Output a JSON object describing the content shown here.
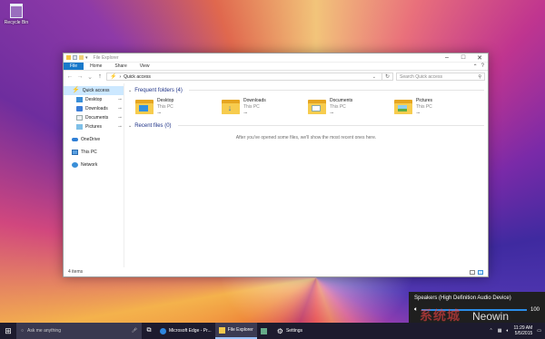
{
  "desktop": {
    "recycle_bin_label": "Recycle Bin"
  },
  "window": {
    "title": "File Explorer",
    "controls": {
      "minimize": "–",
      "maximize": "□",
      "close": "✕"
    },
    "ribbon_tabs": [
      "File",
      "Home",
      "Share",
      "View"
    ],
    "ribbon_right": {
      "collapse": "⌃",
      "help": "?"
    },
    "address": {
      "location": "Quick access",
      "search_placeholder": "Search Quick access"
    }
  },
  "nav_pane": {
    "quick_access": "Quick access",
    "pinned": [
      "Desktop",
      "Downloads",
      "Documents",
      "Pictures"
    ],
    "onedrive": "OneDrive",
    "this_pc": "This PC",
    "network": "Network"
  },
  "content": {
    "frequent_header": "Frequent folders (4)",
    "folders": [
      {
        "name": "Desktop",
        "location": "This PC"
      },
      {
        "name": "Downloads",
        "location": "This PC"
      },
      {
        "name": "Documents",
        "location": "This PC"
      },
      {
        "name": "Pictures",
        "location": "This PC"
      }
    ],
    "recent_header": "Recent files (0)",
    "recent_empty": "After you've opened some files, we'll show the most recent ones here."
  },
  "status_bar": {
    "item_count": "4 items"
  },
  "volume_flyout": {
    "device": "Speakers (High Definition Audio Device)",
    "level": 100,
    "level_label": "100"
  },
  "watermark": {
    "text_cn": "系统城",
    "text_en": "Neowin"
  },
  "taskbar": {
    "search_placeholder": "Ask me anything",
    "apps": [
      "Microsoft Edge - Pr...",
      "File Explorer",
      "",
      "Settings"
    ],
    "time": "11:29 AM",
    "date": "5/5/2015"
  }
}
